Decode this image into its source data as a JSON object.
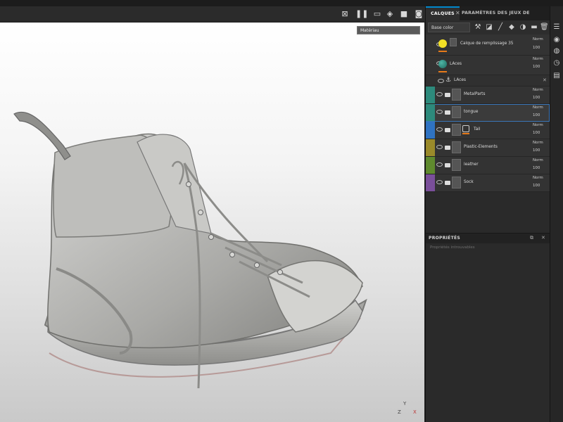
{
  "toolbar": {
    "icons": [
      "grid-icon",
      "pause-icon",
      "camera-icon",
      "cube-icon",
      "video-icon",
      "screenshot-icon"
    ]
  },
  "viewport": {
    "view_mode": "Matériau",
    "axis": {
      "y": "Y",
      "z": "Z",
      "x": "X"
    }
  },
  "layers_panel": {
    "tabs": [
      {
        "label": "CALQUES",
        "active": true
      },
      {
        "label": "PARAMÈTRES DES JEUX DE TEXTURES",
        "active": false
      }
    ],
    "channel": "Base color",
    "layers": [
      {
        "name": "Calque de remplissage 35",
        "type": "fill",
        "blend": "Norm",
        "opacity": "100",
        "color": "#333333"
      },
      {
        "name": "LAces",
        "type": "paint",
        "blend": "Norm",
        "opacity": "100",
        "color": "#333333"
      },
      {
        "name": "LAces",
        "type": "anchor",
        "blend": "",
        "opacity": "",
        "color": "#333333"
      },
      {
        "name": "MetalParts",
        "type": "folder",
        "blend": "Norm",
        "opacity": "100",
        "color": "#2d8a7c"
      },
      {
        "name": "tongue",
        "type": "folder",
        "blend": "Norm",
        "opacity": "100",
        "color": "#2d8a7c",
        "selected": true
      },
      {
        "name": "Tail",
        "type": "folder",
        "blend": "Norm",
        "opacity": "100",
        "color": "#2f73c2"
      },
      {
        "name": "Plastic-Elements",
        "type": "folder",
        "blend": "Norm",
        "opacity": "100",
        "color": "#9a8a2a"
      },
      {
        "name": "leather",
        "type": "folder",
        "blend": "Norm",
        "opacity": "100",
        "color": "#5f8a2e"
      },
      {
        "name": "Sock",
        "type": "folder",
        "blend": "Norm",
        "opacity": "100",
        "color": "#7a4f9a"
      }
    ]
  },
  "properties_panel": {
    "title": "PROPRIÉTÉS",
    "hint": "Propriétés introuvables"
  },
  "right_strip": {
    "icons": [
      "layers-icon",
      "camera-icon",
      "globe-icon",
      "history-icon",
      "document-icon"
    ]
  }
}
